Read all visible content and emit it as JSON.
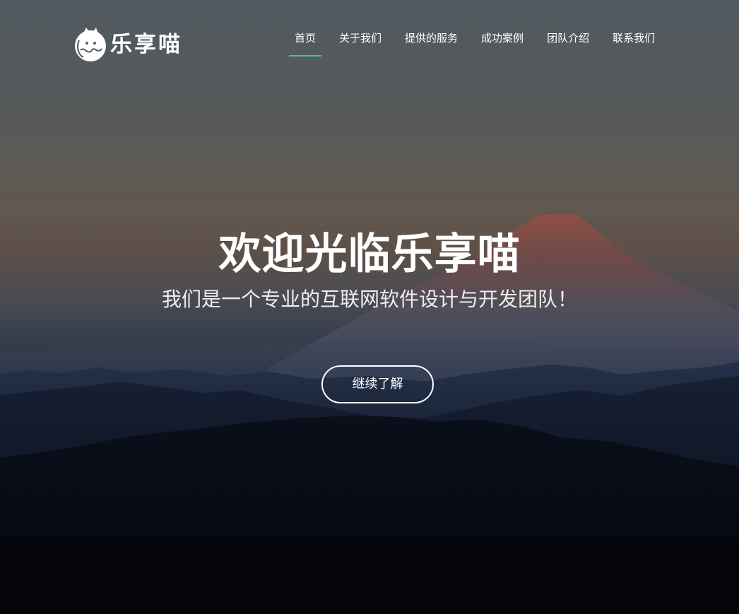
{
  "brand": {
    "name": "乐享喵",
    "logo_icon": "cat-icon"
  },
  "nav": {
    "items": [
      {
        "label": "首页",
        "active": true
      },
      {
        "label": "关于我们",
        "active": false
      },
      {
        "label": "提供的服务",
        "active": false
      },
      {
        "label": "成功案例",
        "active": false
      },
      {
        "label": "团队介绍",
        "active": false
      },
      {
        "label": "联系我们",
        "active": false
      }
    ],
    "active_color": "#3dc5a3"
  },
  "hero": {
    "title": "欢迎光临乐享喵",
    "subtitle": "我们是一个专业的互联网软件设计与开发团队！",
    "cta_label": "继续了解"
  }
}
